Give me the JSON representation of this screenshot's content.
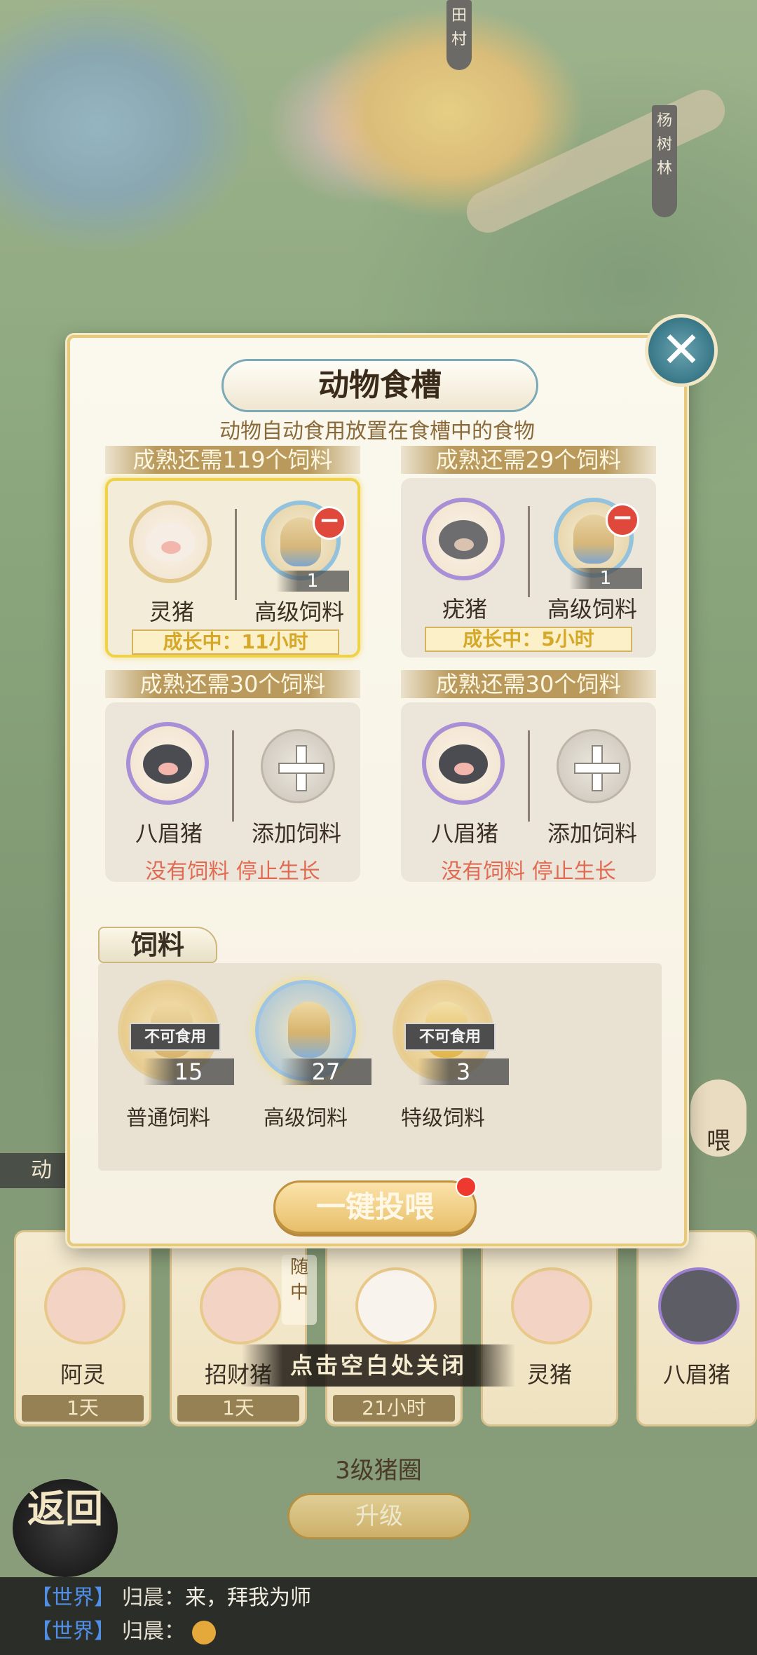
{
  "map": {
    "banner_top": "田村",
    "banner_right": "杨树林"
  },
  "modal": {
    "title": "动物食槽",
    "subtitle": "动物自动食用放置在食槽中的食物",
    "slots": [
      {
        "header": "成熟还需119个饲料",
        "animal": "灵猪",
        "feed": "高级饲料",
        "feed_count": "1",
        "status": "成长中：11小时"
      },
      {
        "header": "成熟还需29个饲料",
        "animal": "疣猪",
        "feed": "高级饲料",
        "feed_count": "1",
        "status": "成长中：5小时"
      },
      {
        "header": "成熟还需30个饲料",
        "animal": "八眉猪",
        "feed": "添加饲料",
        "status": "没有饲料  停止生长"
      },
      {
        "header": "成熟还需30个饲料",
        "animal": "八眉猪",
        "feed": "添加饲料",
        "status": "没有饲料  停止生长"
      }
    ],
    "feed_section": {
      "tab": "饲料",
      "inedible": "不可食用",
      "items": [
        {
          "name": "普通饲料",
          "count": "15"
        },
        {
          "name": "高级饲料",
          "count": "27"
        },
        {
          "name": "特级饲料",
          "count": "3"
        }
      ]
    },
    "one_key_button": "一键投喂"
  },
  "background_ui": {
    "side_label": "动",
    "feed_right": "喂",
    "follow_tag": "随中",
    "close_hint": "点击空白处关闭",
    "pen_cards": [
      {
        "name": "阿灵",
        "time": "1天"
      },
      {
        "name": "招财猪",
        "time": "1天"
      },
      {
        "name": "",
        "time": "21小时"
      },
      {
        "name": "灵猪",
        "time": ""
      },
      {
        "name": "八眉猪",
        "time": ""
      }
    ],
    "pen_level": "3级猪圈",
    "upgrade_button": "升级",
    "back_button": "返回"
  },
  "chat": [
    {
      "channel": "【世界】",
      "user": "归晨：",
      "message": "来，拜我为师"
    },
    {
      "channel": "【世界】",
      "user": "归晨：",
      "message": ""
    }
  ]
}
